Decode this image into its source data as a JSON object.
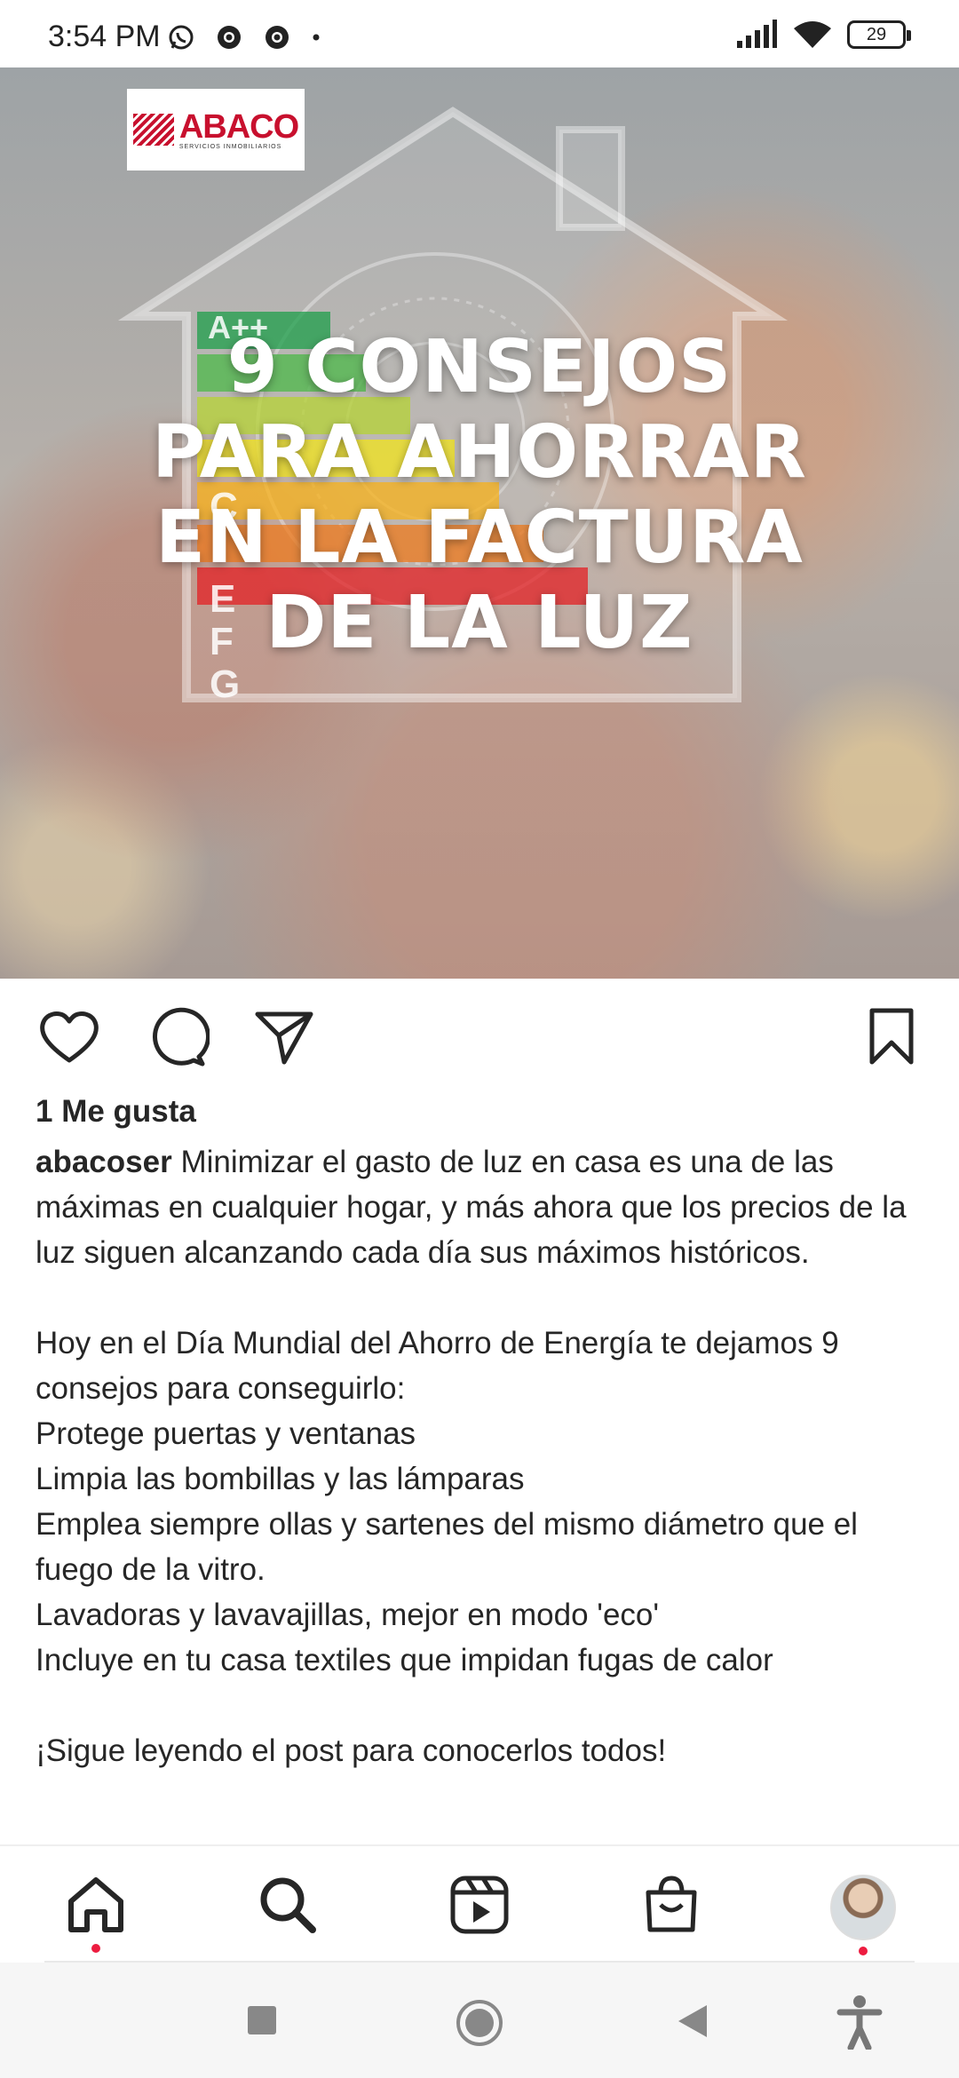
{
  "status_bar": {
    "time": "3:54 PM",
    "left_icons": [
      "whatsapp-icon",
      "chrome-icon",
      "chrome-icon",
      "dot-icon"
    ],
    "right_icons": [
      "signal-icon",
      "wifi-icon",
      "battery-icon"
    ],
    "battery_level": "29"
  },
  "post": {
    "image": {
      "logo_text": "ABACO",
      "logo_subtext": "SERVICIOS INMOBILIARIOS",
      "energy_grades": [
        "A++",
        "C",
        "E",
        "F",
        "G"
      ],
      "headline": [
        "9 CONSEJOS",
        "PARA AHORRAR",
        "EN LA FACTURA",
        "DE LA LUZ"
      ]
    },
    "actions": [
      "heart-icon",
      "comment-icon",
      "share-icon",
      "bookmark-icon"
    ],
    "likes": "1 Me gusta",
    "caption": {
      "username": "abacoser",
      "intro": " Minimizar el gasto de luz en casa es una de las máximas en cualquier hogar, y más ahora que los precios de la luz siguen alcanzando cada día sus máximos históricos.",
      "lines": [
        "Hoy en el Día Mundial del Ahorro de Energía te dejamos 9 consejos para conseguirlo:",
        "Protege puertas y ventanas",
        "Limpia las bombillas y las lámparas",
        "Emplea siempre ollas y sartenes del mismo diámetro que el fuego de la vitro.",
        "Lavadoras y lavavajillas, mejor en modo 'eco'",
        "Incluye en tu casa textiles que impidan fugas de calor"
      ],
      "outro": "¡Sigue leyendo el post para conocerlos todos!"
    }
  },
  "bottom_nav": {
    "items": [
      "home-icon",
      "search-icon",
      "reels-icon",
      "shop-icon",
      "profile-avatar"
    ],
    "badge_color": "#ed1c40"
  },
  "system_nav": [
    "recent-apps-icon",
    "home-circle-icon",
    "back-icon",
    "accessibility-icon"
  ]
}
